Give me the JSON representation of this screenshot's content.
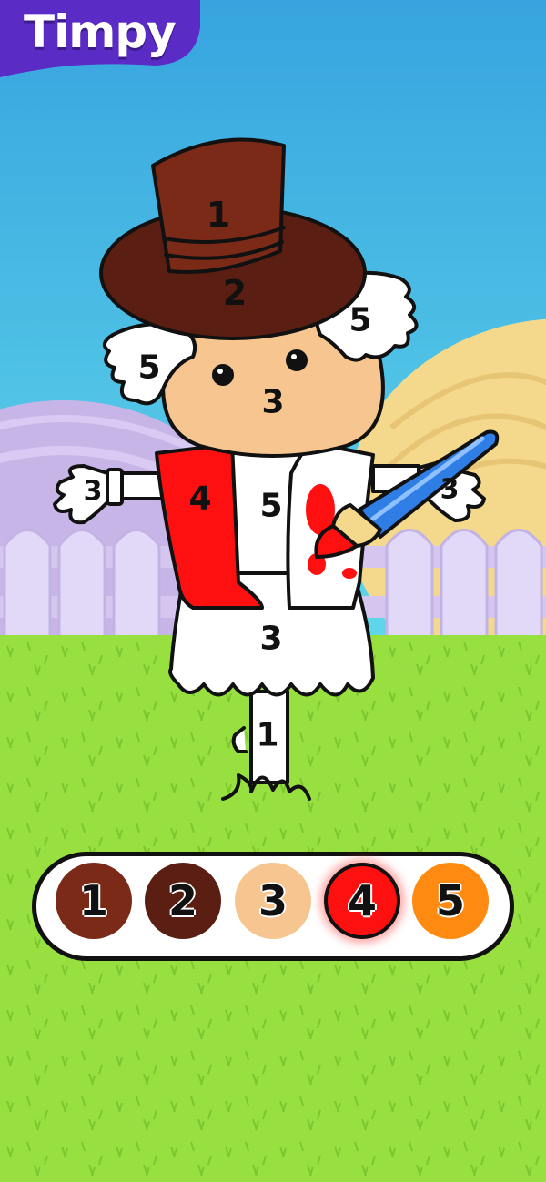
{
  "app": {
    "logo_text": "Timpy",
    "brand_color": "#5b2bc6"
  },
  "puzzle": {
    "labels": {
      "hat_top": "1",
      "hat_brim": "2",
      "hair_right": "5",
      "hair_left": "5",
      "face": "3",
      "hand_left": "3",
      "hand_right": "3",
      "scarf_left": "4",
      "shirt_center": "5",
      "skirt": "3",
      "pole": "1"
    }
  },
  "palette": {
    "selected_index": 3,
    "swatches": [
      {
        "number": "1",
        "color": "#7a2a17"
      },
      {
        "number": "2",
        "color": "#5a1e12"
      },
      {
        "number": "3",
        "color": "#f7c690"
      },
      {
        "number": "4",
        "color": "#ff1010"
      },
      {
        "number": "5",
        "color": "#ff8a12"
      }
    ]
  },
  "colors": {
    "sky_top": "#3aa8e0",
    "sky_bottom": "#5ad2e8",
    "grass": "#98e040",
    "fence": "#d9cdf2",
    "hill_left": "#c7b5e8",
    "hill_right": "#f4d98c"
  }
}
